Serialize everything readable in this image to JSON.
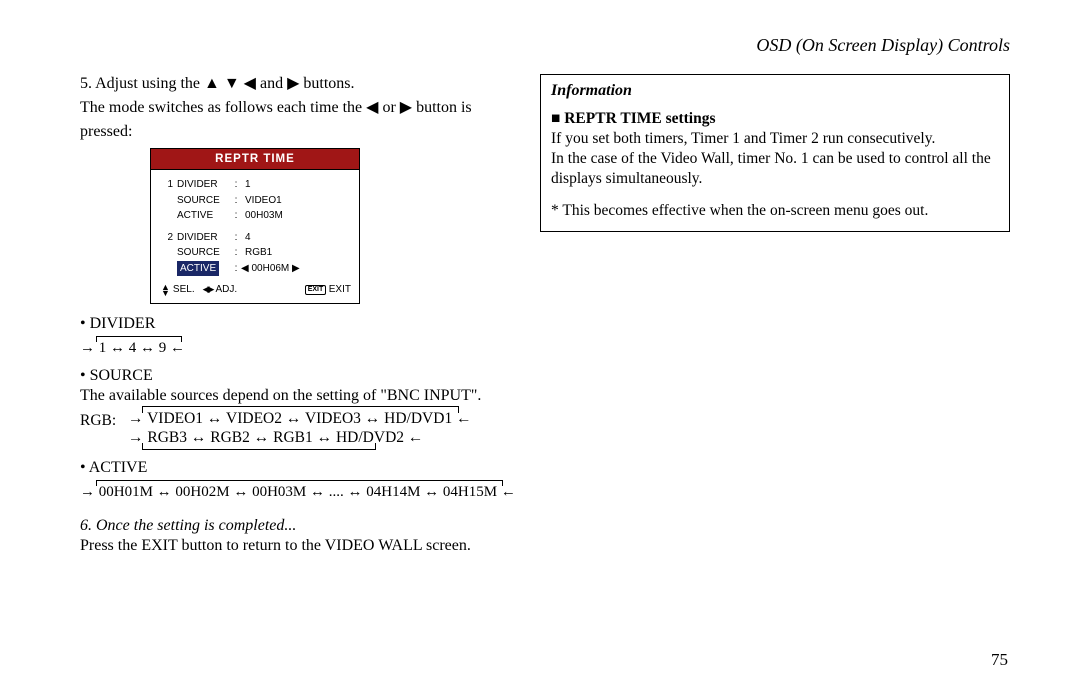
{
  "header": "OSD (On Screen Display) Controls",
  "left": {
    "step5_l1": "5. Adjust using the ▲ ▼ ◀ and ▶ buttons.",
    "step5_l2": "The mode switches as follows each time the ◀ or ▶ button is",
    "step5_l3": "pressed:",
    "osd": {
      "title": "REPTR TIME",
      "r1_num": "1",
      "r1_label": "DIVIDER",
      "r1_val": "1",
      "r2_label": "SOURCE",
      "r2_val": "VIDEO1",
      "r3_label": "ACTIVE",
      "r3_val": "00H03M",
      "r4_num": "2",
      "r4_label": "DIVIDER",
      "r4_val": "4",
      "r5_label": "SOURCE",
      "r5_val": "RGB1",
      "r6_label": "ACTIVE",
      "r6_val": "◀ 00H06M ▶",
      "foot_sel": "SEL.",
      "foot_adj": "ADJ.",
      "foot_exit_icon": "EXIT",
      "foot_exit": "EXIT"
    },
    "divider_head": "• DIVIDER",
    "divider_cycle": "→ 1 ↔ 4 ↔ 9 ←",
    "source_head": "• SOURCE",
    "source_note": "The available sources depend on the setting of \"BNC INPUT\".",
    "rgb_prefix": "RGB:",
    "rgb_line1": "→ VIDEO1 ↔ VIDEO2 ↔ VIDEO3 ↔ HD/DVD1 ←",
    "rgb_line2": "→ RGB3 ↔ RGB2 ↔ RGB1 ↔ HD/DVD2 ←",
    "active_head": "• ACTIVE",
    "active_cycle": "→ 00H01M ↔ 00H02M ↔ 00H03M ↔ .... ↔ 04H14M ↔ 04H15M ←",
    "step6_head": "6. Once the setting is completed...",
    "step6_body": "Press the EXIT button to return to the VIDEO WALL screen."
  },
  "info": {
    "title": "Information",
    "sub": "■ REPTR TIME settings",
    "p1": "If you set both timers, Timer 1 and Timer 2 run consecutively.",
    "p2": "In the case of the Video Wall, timer No. 1 can be used to control all the displays simultaneously.",
    "p3": "* This becomes effective when the on-screen menu goes out."
  },
  "pagenum": "75"
}
